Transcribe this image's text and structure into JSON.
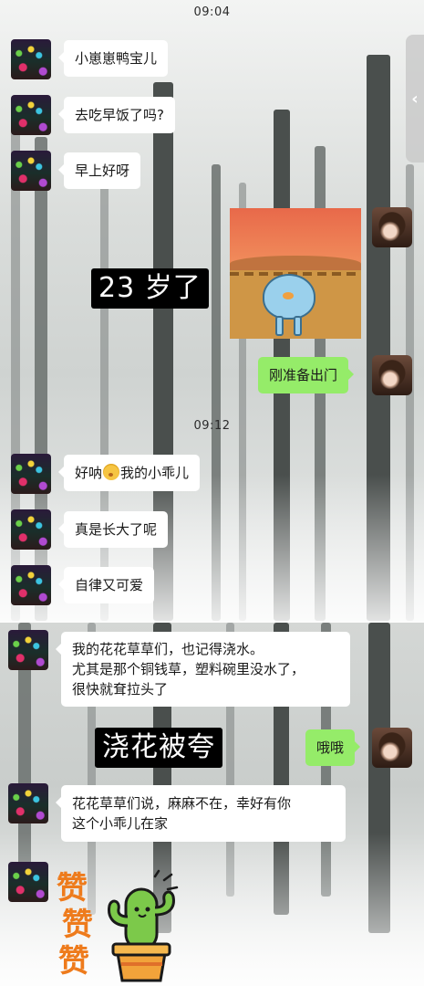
{
  "timestamps": [
    "09:04",
    "09:12"
  ],
  "side_handle": {
    "icon": "chevron-left-icon",
    "glyph": "‹"
  },
  "messages": [
    {
      "side": "left",
      "text": "小崽崽鸭宝儿"
    },
    {
      "side": "left",
      "text": "去吃早饭了吗?"
    },
    {
      "side": "left",
      "text": "早上好呀"
    },
    {
      "side": "right",
      "type": "sticker",
      "icon": "desert-creature-sticker"
    },
    {
      "side": "right",
      "text": "刚准备出门"
    },
    {
      "side": "left",
      "text_before": "好呐",
      "emoji": "grin-emoji",
      "text_after": "我的小乖儿"
    },
    {
      "side": "left",
      "text": "真是长大了呢"
    },
    {
      "side": "left",
      "text": "自律又可爱"
    },
    {
      "side": "left",
      "lines": [
        "我的花花草草们，也记得浇水。",
        "尤其是那个铜钱草，塑料碗里没水了，",
        "很快就耷拉头了"
      ]
    },
    {
      "side": "right",
      "text": "哦哦"
    },
    {
      "side": "left",
      "lines": [
        "花花草草们说，麻麻不在，幸好有你",
        "这个小乖儿在家"
      ]
    },
    {
      "side": "left",
      "type": "sticker",
      "icon": "cactus-praise-sticker",
      "text": [
        "赞",
        "赞",
        "赞"
      ]
    }
  ],
  "captions": [
    "23 岁了",
    "浇花被夸"
  ],
  "colors": {
    "bubble_self": "#95ec69",
    "bubble_other": "#ffffff",
    "caption_bg": "#000000",
    "praise_text": "#ee7b1c"
  }
}
